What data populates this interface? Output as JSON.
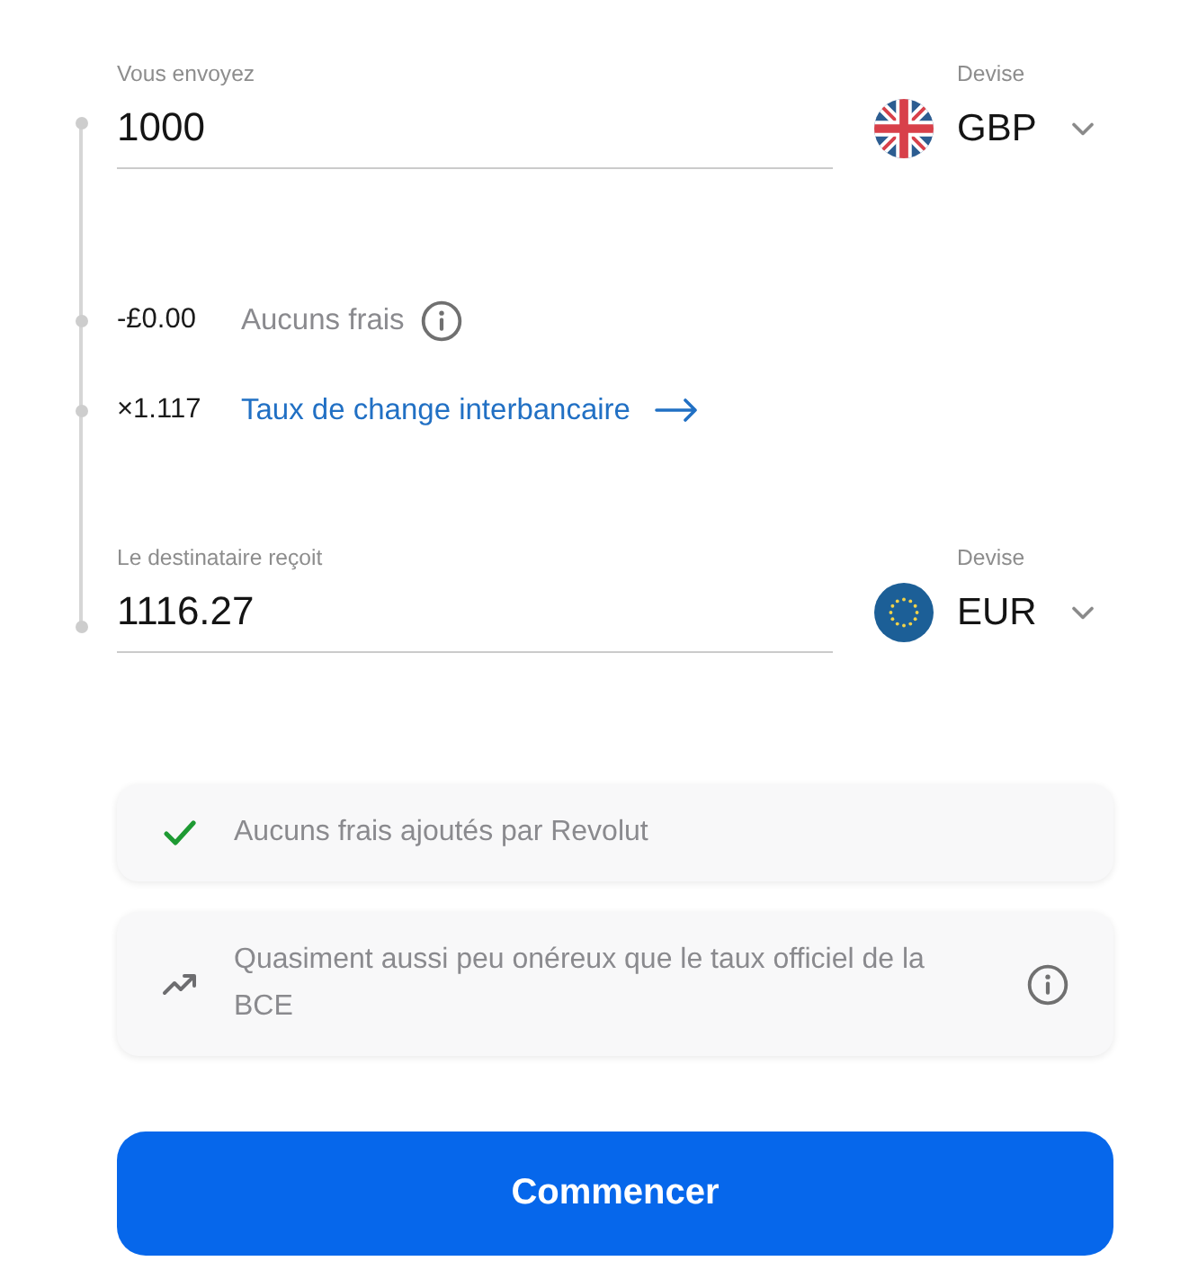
{
  "send": {
    "label": "Vous envoyez",
    "value": "1000",
    "currency_label": "Devise",
    "currency": "GBP"
  },
  "fee": {
    "amount": "-£0.00",
    "label": "Aucuns frais"
  },
  "rate": {
    "value": "×1.117",
    "link": "Taux de change interbancaire"
  },
  "receive": {
    "label": "Le destinataire reçoit",
    "value": "1116.27",
    "currency_label": "Devise",
    "currency": "EUR"
  },
  "notes": [
    {
      "kind": "check",
      "text": "Aucuns frais ajoutés par Revolut",
      "info": false
    },
    {
      "kind": "trend",
      "text": "Quasiment aussi peu onéreux que le taux officiel de la BCE",
      "info": true
    }
  ],
  "start_button": "Commencer"
}
